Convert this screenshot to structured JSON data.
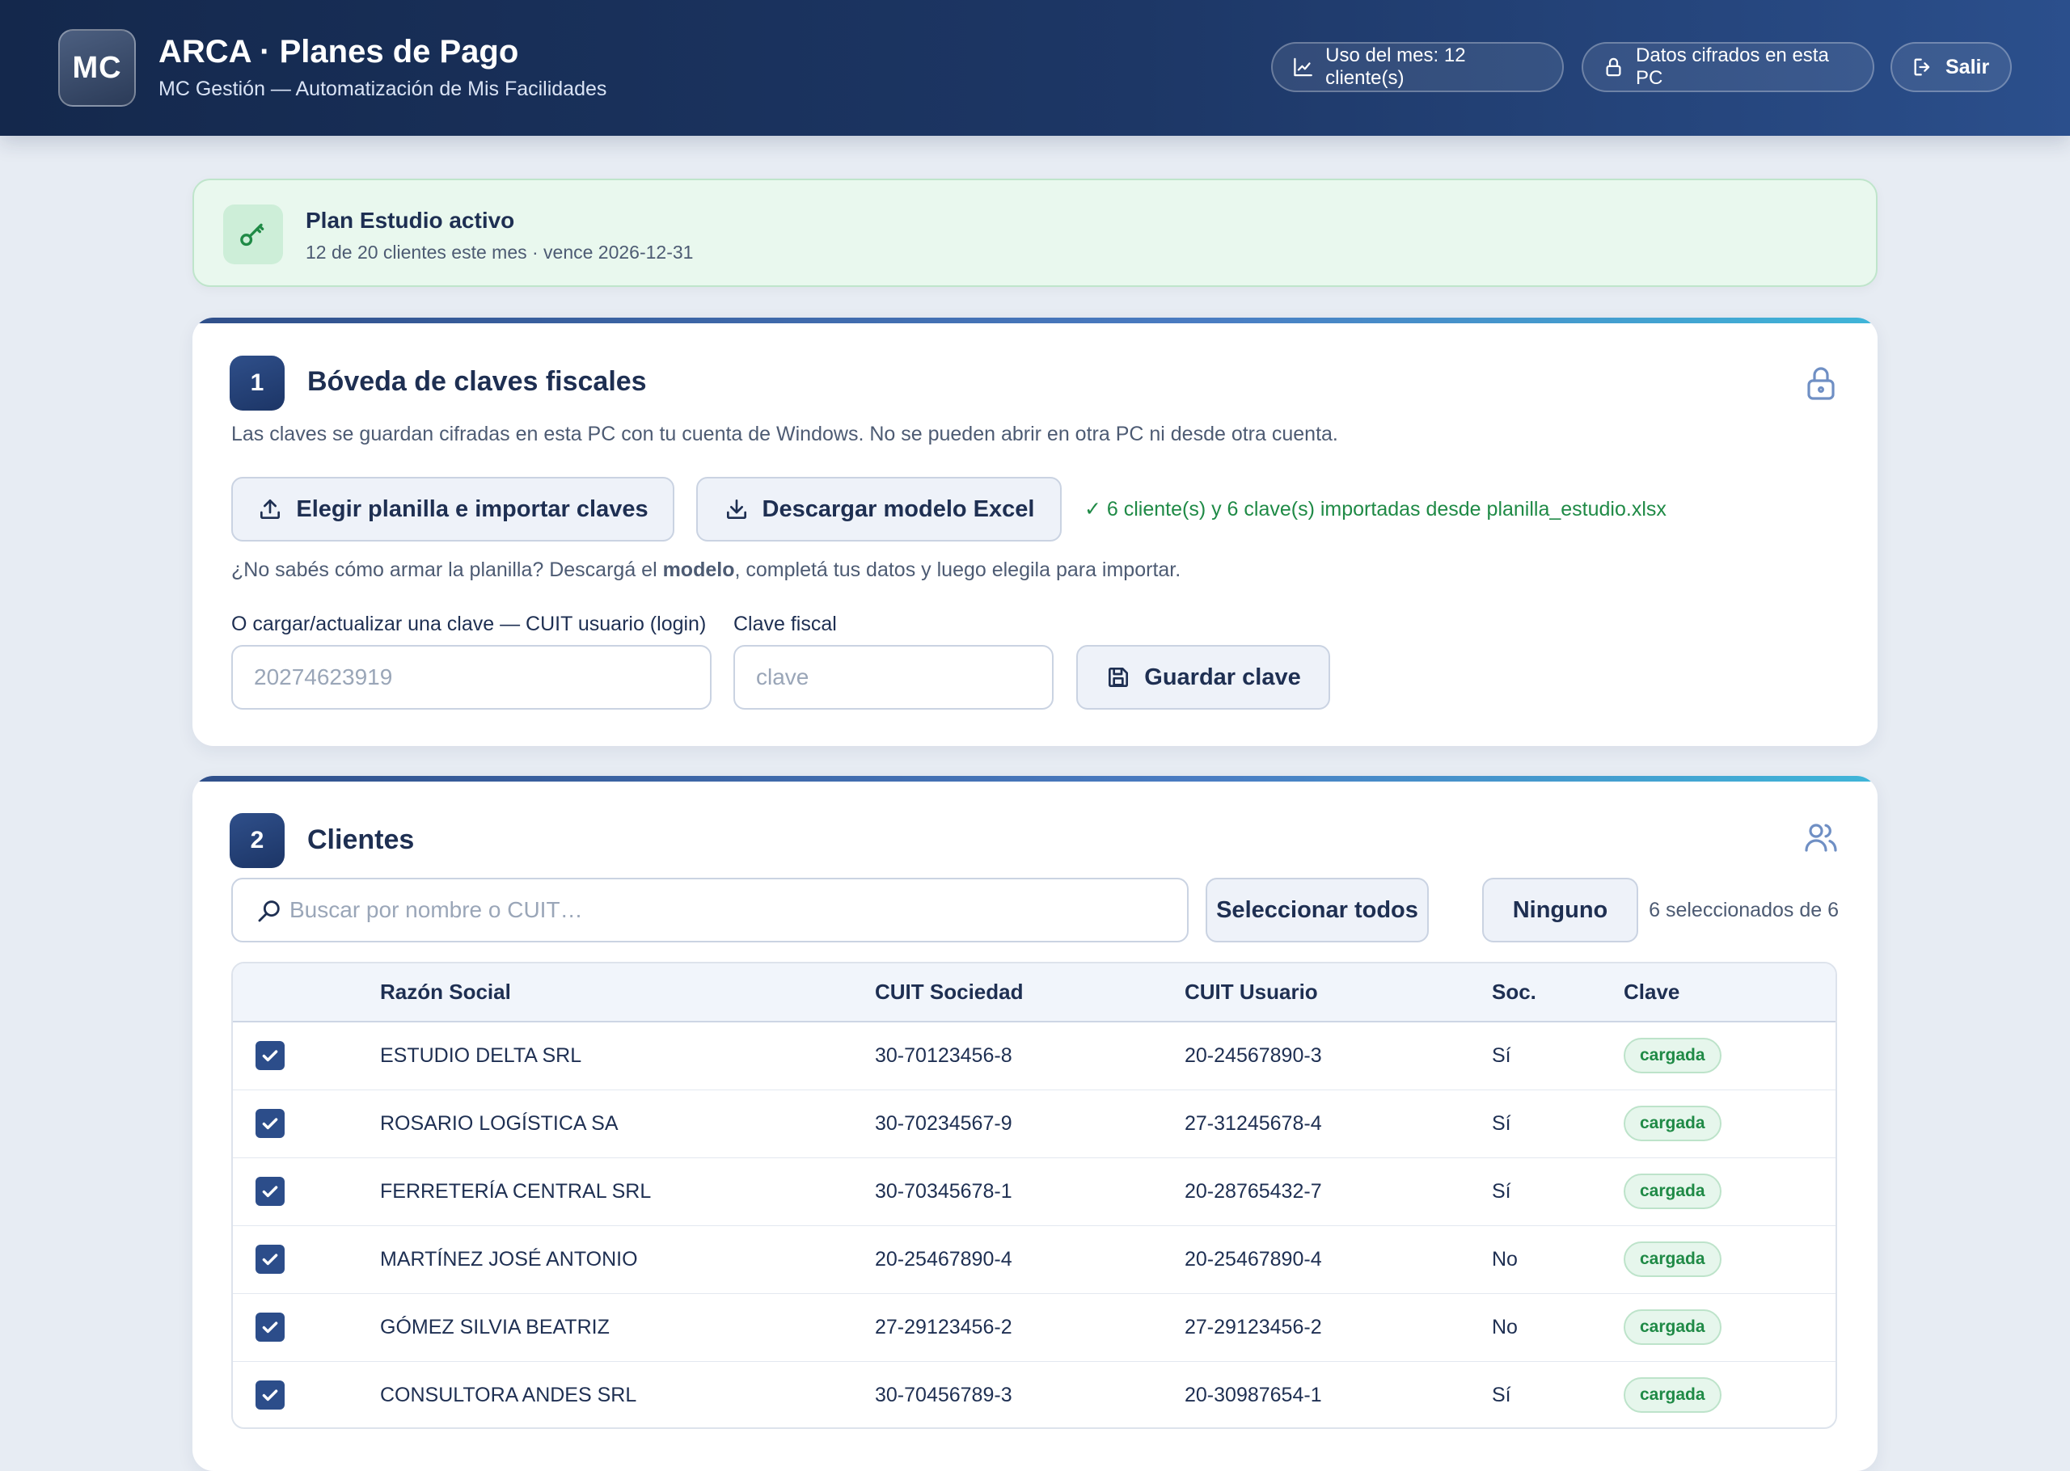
{
  "header": {
    "logo_text": "MC",
    "title": "ARCA · Planes de Pago",
    "subtitle": "MC Gestión — Automatización de Mis Facilidades",
    "usage_label": "Uso del mes: 12 cliente(s)",
    "secure_label": "Datos cifrados en esta PC",
    "exit_label": "Salir"
  },
  "plan": {
    "title": "Plan Estudio activo",
    "detail": "12 de 20 clientes este mes · vence 2026-12-31"
  },
  "vault": {
    "step": "1",
    "title": "Bóveda de claves fiscales",
    "description": "Las claves se guardan cifradas en esta PC con tu cuenta de Windows. No se pueden abrir en otra PC ni desde otra cuenta.",
    "import_button": "Elegir planilla e importar claves",
    "model_button": "Descargar modelo Excel",
    "import_status": "✓ 6 cliente(s) y 6 clave(s) importadas desde planilla_estudio.xlsx",
    "help_before": "¿No sabés cómo armar la planilla? Descargá el ",
    "help_bold": "modelo",
    "help_after": ", completá tus datos y luego elegila para importar.",
    "cuit_label": "O cargar/actualizar una clave — CUIT usuario (login)",
    "cuit_placeholder": "20274623919",
    "clave_label": "Clave fiscal",
    "clave_placeholder": "clave",
    "save_button": "Guardar clave"
  },
  "clients": {
    "step": "2",
    "title": "Clientes",
    "search_placeholder": "Buscar por nombre o CUIT…",
    "select_all": "Seleccionar todos",
    "select_none": "Ninguno",
    "selection_count": "6 seleccionados de 6",
    "columns": [
      "Razón Social",
      "CUIT Sociedad",
      "CUIT Usuario",
      "Soc.",
      "Clave"
    ],
    "rows": [
      {
        "name": "ESTUDIO DELTA SRL",
        "cuit_sociedad": "30-70123456-8",
        "cuit_usuario": "20-24567890-3",
        "soc": "Sí",
        "clave": "cargada",
        "checked": true
      },
      {
        "name": "ROSARIO LOGÍSTICA SA",
        "cuit_sociedad": "30-70234567-9",
        "cuit_usuario": "27-31245678-4",
        "soc": "Sí",
        "clave": "cargada",
        "checked": true
      },
      {
        "name": "FERRETERÍA CENTRAL SRL",
        "cuit_sociedad": "30-70345678-1",
        "cuit_usuario": "20-28765432-7",
        "soc": "Sí",
        "clave": "cargada",
        "checked": true
      },
      {
        "name": "MARTÍNEZ JOSÉ ANTONIO",
        "cuit_sociedad": "20-25467890-4",
        "cuit_usuario": "20-25467890-4",
        "soc": "No",
        "clave": "cargada",
        "checked": true
      },
      {
        "name": "GÓMEZ SILVIA BEATRIZ",
        "cuit_sociedad": "27-29123456-2",
        "cuit_usuario": "27-29123456-2",
        "soc": "No",
        "clave": "cargada",
        "checked": true
      },
      {
        "name": "CONSULTORA ANDES SRL",
        "cuit_sociedad": "30-70456789-3",
        "cuit_usuario": "20-30987654-1",
        "soc": "Sí",
        "clave": "cargada",
        "checked": true
      }
    ]
  },
  "icons": {
    "usage": "chart-line-icon",
    "secure": "lock-icon",
    "exit": "logout-icon",
    "plan": "key-icon",
    "vault": "lock-icon",
    "import": "upload-icon",
    "model": "download-icon",
    "save": "save-icon",
    "clients": "users-icon",
    "search": "magnifier-icon",
    "checkbox": "check-icon"
  },
  "colors": {
    "header_start": "#14284c",
    "header_end": "#2b4f8c",
    "accent": "#2c4d8a",
    "success": "#1f8a46",
    "plan_bg": "#e9f8ee"
  }
}
